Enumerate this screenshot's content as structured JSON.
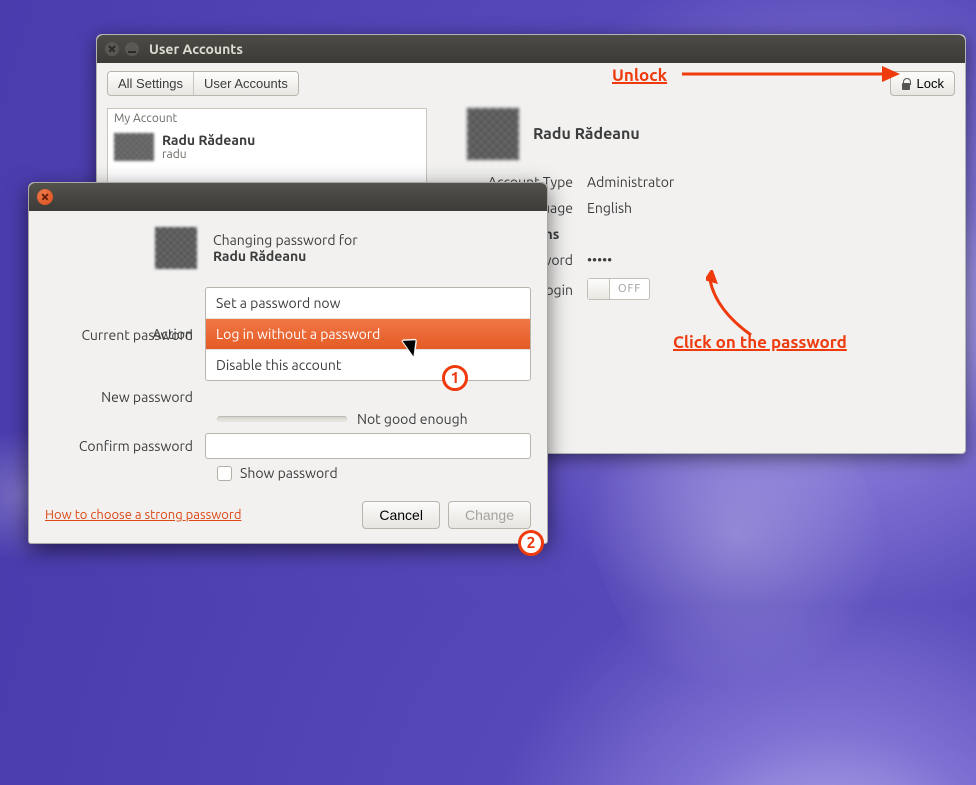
{
  "ua_window": {
    "title": "User Accounts",
    "breadcrumb": {
      "all_settings": "All Settings",
      "current": "User Accounts"
    },
    "lock_label": "Lock",
    "list": {
      "group": "My Account",
      "item": {
        "fullname": "Radu Rădeanu",
        "username": "radu"
      }
    },
    "details": {
      "fullname": "Radu Rădeanu",
      "account_type_label": "Account Type",
      "account_type": "Administrator",
      "language_label": "Language",
      "language": "English",
      "login_options_label": "Login Options",
      "password_label": "Password",
      "password_display": "•••••",
      "auto_login_label": "Automatic Login",
      "auto_login_state": "OFF"
    }
  },
  "pw_dialog": {
    "changing_for": "Changing password for",
    "fullname": "Radu Rădeanu",
    "labels": {
      "action": "Action",
      "current": "Current password",
      "new": "New password",
      "confirm": "Confirm password",
      "show": "Show password",
      "strength": "Not good enough"
    },
    "options": {
      "set_now": "Set a password now",
      "no_password": "Log in without a password",
      "disable": "Disable this account"
    },
    "help_link": "How to choose a strong password",
    "cancel": "Cancel",
    "change": "Change"
  },
  "annotations": {
    "unlock": "Unlock",
    "click_pw": "Click on the password",
    "one": "1",
    "two": "2"
  }
}
